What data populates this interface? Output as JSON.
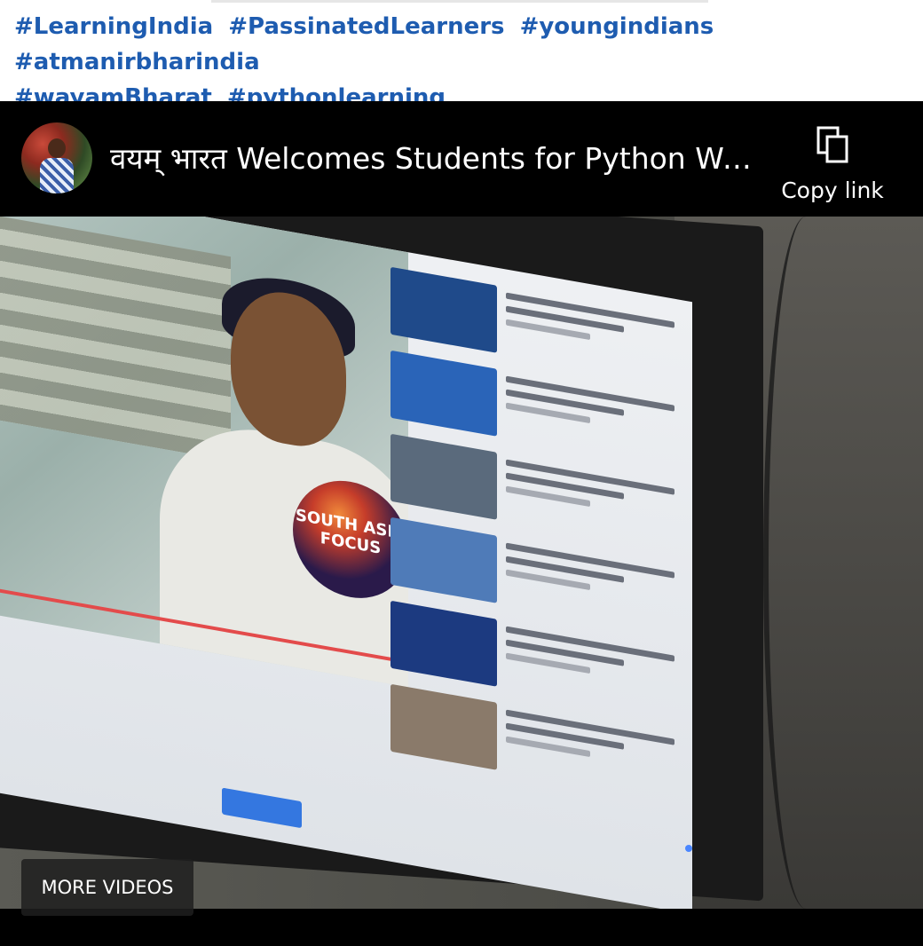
{
  "post": {
    "hashtags": [
      "#LearningIndia",
      "#PassinatedLearners",
      "#youngindians",
      "#atmanirbharindia",
      "#wayamBharat",
      "#pythonlearning"
    ]
  },
  "player": {
    "title": "वयम् भारत Welcomes Students for Python We...",
    "copy_link_label": "Copy link",
    "copy_link_icon": "copy-icon",
    "more_videos_label": "MORE VIDEOS"
  },
  "video_frame": {
    "badge_text": "SOUTH ASIA FOCUS"
  },
  "colors": {
    "hashtag": "#1e5cb0",
    "player_bg": "#000000",
    "text_on_dark": "#ffffff"
  }
}
